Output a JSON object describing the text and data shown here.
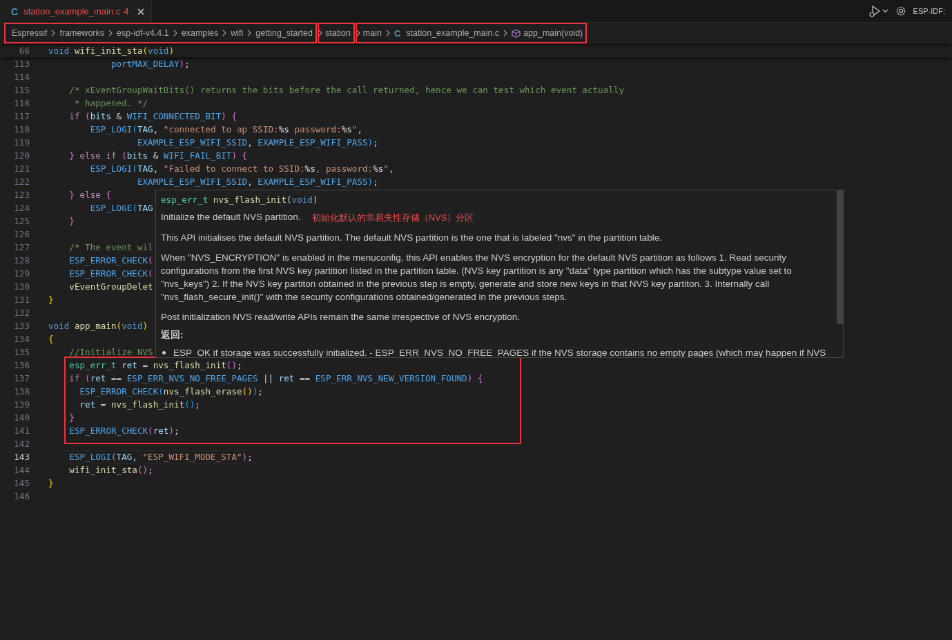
{
  "tab": {
    "icon": "C",
    "label": "station_example_main.c",
    "problems": "4",
    "selected": true
  },
  "toolbar": {
    "label": "ESP-IDF:"
  },
  "breadcrumb_groups": [
    {
      "framed": true,
      "items": [
        {
          "label": "Espressif",
          "kind": "folder"
        },
        {
          "label": "frameworks",
          "kind": "folder"
        },
        {
          "label": "esp-idf-v4.4.1",
          "kind": "folder"
        },
        {
          "label": "examples",
          "kind": "folder"
        },
        {
          "label": "wifi",
          "kind": "folder"
        },
        {
          "label": "getting_started",
          "kind": "folder"
        }
      ]
    },
    {
      "framed": true,
      "items": [
        {
          "label": "station",
          "kind": "folder"
        }
      ]
    },
    {
      "framed": true,
      "items": [
        {
          "label": "main",
          "kind": "folder"
        },
        {
          "label": "station_example_main.c",
          "kind": "file",
          "icon": "C"
        },
        {
          "label": "app_main(void)",
          "kind": "symbol"
        }
      ]
    }
  ],
  "sticky_line": {
    "number": "66",
    "tokens": [
      {
        "text": "void ",
        "kind": "kw"
      },
      {
        "text": "wifi_init_sta",
        "kind": "fn"
      },
      {
        "text": "(",
        "kind": "b1"
      },
      {
        "text": "void",
        "kind": "kw"
      },
      {
        "text": ")",
        "kind": "b1"
      }
    ]
  },
  "code_blocks": [
    {
      "framed": false,
      "lines": [
        {
          "number": "113",
          "current": false,
          "tokens": [
            {
              "text": "            portMAX_DELAY",
              "kind": "mac"
            },
            {
              "text": ")",
              "kind": "b2"
            },
            {
              "text": ";",
              "kind": "p"
            }
          ]
        },
        {
          "number": "114",
          "current": false
        },
        {
          "number": "115",
          "current": false,
          "tokens": [
            {
              "text": "    /* xEventGroupWaitBits() returns the bits before the call returned, hence we can test which event actually",
              "kind": "cm"
            }
          ]
        },
        {
          "number": "116",
          "current": false,
          "tokens": [
            {
              "text": "     * happened. */",
              "kind": "cm"
            }
          ]
        },
        {
          "number": "117",
          "current": false,
          "tokens": [
            {
              "text": "    if ",
              "kind": "ctl"
            },
            {
              "text": "(",
              "kind": "b2"
            },
            {
              "text": "bits",
              "kind": "var"
            },
            {
              "text": " & ",
              "kind": "p"
            },
            {
              "text": "WIFI_CONNECTED_BIT",
              "kind": "mac"
            },
            {
              "text": ") ",
              "kind": "b2"
            },
            {
              "text": "{",
              "kind": "b2"
            }
          ]
        },
        {
          "number": "118",
          "current": false,
          "tokens": [
            {
              "text": "        ESP_LOGI",
              "kind": "mac"
            },
            {
              "text": "(",
              "kind": "b3"
            },
            {
              "text": "TAG",
              "kind": "var"
            },
            {
              "text": ", ",
              "kind": "p"
            },
            {
              "text": "\"connected to ap SSID:",
              "kind": "str"
            },
            {
              "text": "%s",
              "kind": "fmt"
            },
            {
              "text": " password:",
              "kind": "str"
            },
            {
              "text": "%s",
              "kind": "fmt"
            },
            {
              "text": "\"",
              "kind": "str"
            },
            {
              "text": ",",
              "kind": "p"
            }
          ]
        },
        {
          "number": "119",
          "current": false,
          "tokens": [
            {
              "text": "                 EXAMPLE_ESP_WIFI_SSID",
              "kind": "mac"
            },
            {
              "text": ", ",
              "kind": "p"
            },
            {
              "text": "EXAMPLE_ESP_WIFI_PASS",
              "kind": "mac"
            },
            {
              "text": ")",
              "kind": "b3"
            },
            {
              "text": ";",
              "kind": "p"
            }
          ]
        },
        {
          "number": "120",
          "current": false,
          "tokens": [
            {
              "text": "    } ",
              "kind": "b2"
            },
            {
              "text": "else if ",
              "kind": "ctl"
            },
            {
              "text": "(",
              "kind": "b2"
            },
            {
              "text": "bits",
              "kind": "var"
            },
            {
              "text": " & ",
              "kind": "p"
            },
            {
              "text": "WIFI_FAIL_BIT",
              "kind": "mac"
            },
            {
              "text": ") ",
              "kind": "b2"
            },
            {
              "text": "{",
              "kind": "b2"
            }
          ]
        },
        {
          "number": "121",
          "current": false,
          "tokens": [
            {
              "text": "        ESP_LOGI",
              "kind": "mac"
            },
            {
              "text": "(",
              "kind": "b3"
            },
            {
              "text": "TAG",
              "kind": "var"
            },
            {
              "text": ", ",
              "kind": "p"
            },
            {
              "text": "\"Failed to connect to SSID:",
              "kind": "str"
            },
            {
              "text": "%s",
              "kind": "fmt"
            },
            {
              "text": ", password:",
              "kind": "str"
            },
            {
              "text": "%s",
              "kind": "fmt"
            },
            {
              "text": "\"",
              "kind": "str"
            },
            {
              "text": ",",
              "kind": "p"
            }
          ]
        },
        {
          "number": "122",
          "current": false,
          "tokens": [
            {
              "text": "                 EXAMPLE_ESP_WIFI_SSID",
              "kind": "mac"
            },
            {
              "text": ", ",
              "kind": "p"
            },
            {
              "text": "EXAMPLE_ESP_WIFI_PASS",
              "kind": "mac"
            },
            {
              "text": ")",
              "kind": "b3"
            },
            {
              "text": ";",
              "kind": "p"
            }
          ]
        },
        {
          "number": "123",
          "current": false,
          "tokens": [
            {
              "text": "    } ",
              "kind": "b2"
            },
            {
              "text": "else ",
              "kind": "ctl"
            },
            {
              "text": "{",
              "kind": "b2"
            }
          ]
        },
        {
          "number": "124",
          "current": false,
          "tokens": [
            {
              "text": "        ESP_LOGE",
              "kind": "mac"
            },
            {
              "text": "(",
              "kind": "b3"
            },
            {
              "text": "TAG",
              "kind": "var"
            }
          ]
        },
        {
          "number": "125",
          "current": false,
          "tokens": [
            {
              "text": "    }",
              "kind": "b2"
            }
          ]
        },
        {
          "number": "126",
          "current": false
        },
        {
          "number": "127",
          "current": false,
          "tokens": [
            {
              "text": "    /* The event wil",
              "kind": "cm"
            }
          ]
        },
        {
          "number": "128",
          "current": false,
          "tokens": [
            {
              "text": "    ESP_ERROR_CHECK",
              "kind": "mac"
            },
            {
              "text": "(",
              "kind": "b2"
            }
          ]
        },
        {
          "number": "129",
          "current": false,
          "tokens": [
            {
              "text": "    ESP_ERROR_CHECK",
              "kind": "mac"
            },
            {
              "text": "(",
              "kind": "b2"
            }
          ]
        },
        {
          "number": "130",
          "current": false,
          "tokens": [
            {
              "text": "    vEventGroupDelet",
              "kind": "fn"
            }
          ]
        },
        {
          "number": "131",
          "current": false,
          "tokens": [
            {
              "text": "}",
              "kind": "b1"
            }
          ]
        },
        {
          "number": "132",
          "current": false
        },
        {
          "number": "133",
          "current": false,
          "tokens": [
            {
              "text": "void ",
              "kind": "kw"
            },
            {
              "text": "app_main",
              "kind": "fn"
            },
            {
              "text": "(",
              "kind": "b1"
            },
            {
              "text": "void",
              "kind": "kw"
            },
            {
              "text": ")",
              "kind": "b1"
            }
          ]
        },
        {
          "number": "134",
          "current": false,
          "tokens": [
            {
              "text": "{",
              "kind": "b1"
            }
          ]
        },
        {
          "number": "135",
          "current": false,
          "tokens": [
            {
              "text": "    //Initialize NVS",
              "kind": "cm"
            }
          ]
        }
      ]
    },
    {
      "framed": true,
      "lines": [
        {
          "number": "136",
          "current": false,
          "tokens": [
            {
              "text": "    esp_err_t ",
              "kind": "type"
            },
            {
              "text": "ret",
              "kind": "var"
            },
            {
              "text": " = ",
              "kind": "p"
            },
            {
              "text": "nvs_flash_init",
              "kind": "fn"
            },
            {
              "text": "()",
              "kind": "b2"
            },
            {
              "text": ";",
              "kind": "p"
            }
          ]
        },
        {
          "number": "137",
          "current": false,
          "tokens": [
            {
              "text": "    if ",
              "kind": "ctl"
            },
            {
              "text": "(",
              "kind": "b2"
            },
            {
              "text": "ret",
              "kind": "var"
            },
            {
              "text": " == ",
              "kind": "p"
            },
            {
              "text": "ESP_ERR_NVS_NO_FREE_PAGES",
              "kind": "mac"
            },
            {
              "text": " || ",
              "kind": "p"
            },
            {
              "text": "ret",
              "kind": "var"
            },
            {
              "text": " == ",
              "kind": "p"
            },
            {
              "text": "ESP_ERR_NVS_NEW_VERSION_FOUND",
              "kind": "mac"
            },
            {
              "text": ") ",
              "kind": "b2"
            },
            {
              "text": "{",
              "kind": "b2"
            }
          ]
        },
        {
          "number": "138",
          "current": false,
          "tokens": [
            {
              "text": "      ESP_ERROR_CHECK",
              "kind": "mac"
            },
            {
              "text": "(",
              "kind": "b3"
            },
            {
              "text": "nvs_flash_erase",
              "kind": "fn"
            },
            {
              "text": "()",
              "kind": "b1"
            },
            {
              "text": ")",
              "kind": "b3"
            },
            {
              "text": ";",
              "kind": "p"
            }
          ]
        },
        {
          "number": "139",
          "current": false,
          "tokens": [
            {
              "text": "      ret",
              "kind": "var"
            },
            {
              "text": " = ",
              "kind": "p"
            },
            {
              "text": "nvs_flash_init",
              "kind": "fn"
            },
            {
              "text": "()",
              "kind": "b3"
            },
            {
              "text": ";",
              "kind": "p"
            }
          ]
        },
        {
          "number": "140",
          "current": false,
          "tokens": [
            {
              "text": "    }",
              "kind": "b2"
            }
          ]
        },
        {
          "number": "141",
          "current": false,
          "tokens": [
            {
              "text": "    ESP_ERROR_CHECK",
              "kind": "mac"
            },
            {
              "text": "(",
              "kind": "b2"
            },
            {
              "text": "ret",
              "kind": "var"
            },
            {
              "text": ")",
              "kind": "b2"
            },
            {
              "text": ";",
              "kind": "p"
            }
          ]
        }
      ]
    },
    {
      "framed": false,
      "lines": [
        {
          "number": "142",
          "current": false
        },
        {
          "number": "143",
          "current": true,
          "tokens": [
            {
              "text": "    ESP_LOGI",
              "kind": "mac"
            },
            {
              "text": "(",
              "kind": "b2"
            },
            {
              "text": "TAG",
              "kind": "var"
            },
            {
              "text": ", ",
              "kind": "p"
            },
            {
              "text": "\"ESP_WIFI_MODE_STA\"",
              "kind": "str"
            },
            {
              "text": ")",
              "kind": "b2"
            },
            {
              "text": ";",
              "kind": "p"
            }
          ]
        },
        {
          "number": "144",
          "current": false,
          "tokens": [
            {
              "text": "    wifi_init_sta",
              "kind": "fn"
            },
            {
              "text": "()",
              "kind": "b2"
            },
            {
              "text": ";",
              "kind": "p"
            }
          ]
        },
        {
          "number": "145",
          "current": false,
          "tokens": [
            {
              "text": "}",
              "kind": "b1"
            }
          ]
        },
        {
          "number": "146",
          "current": false
        }
      ]
    }
  ],
  "hover": {
    "signature": [
      {
        "text": "esp_err_t ",
        "kind": "type"
      },
      {
        "text": "nvs_flash_init",
        "kind": "fn"
      },
      {
        "text": "(",
        "kind": "p"
      },
      {
        "text": "void",
        "kind": "kw"
      },
      {
        "text": ")",
        "kind": "p"
      }
    ],
    "summary": "Initialize the default NVS partition.",
    "translation": "初始化默认的非易失性存储（NVS）分区",
    "paragraphs": [
      "This API initialises the default NVS partition. The default NVS partition is the one that is labeled \"nvs\" in the partition table.",
      "When \"NVS_ENCRYPTION\" is enabled in the menuconfig, this API enables the NVS encryption for the default NVS partition as follows 1. Read security configurations from the first NVS key partition listed in the partition table. (NVS key partition is any \"data\" type partition which has the subtype value set to \"nvs_keys\") 2. If the NVS key partiton obtained in the previous step is empty, generate and store new keys in that NVS key partiton. 3. Internally call \"nvs_flash_secure_init()\" with the security configurations obtained/generated in the previous steps.",
      "Post initialization NVS read/write APIs remain the same irrespective of NVS encryption."
    ],
    "returns_heading": "返回:",
    "returns": [
      "ESP_OK if storage was successfully initialized. - ESP_ERR_NVS_NO_FREE_PAGES if the NVS storage contains no empty pages (which may happen if NVS"
    ]
  }
}
